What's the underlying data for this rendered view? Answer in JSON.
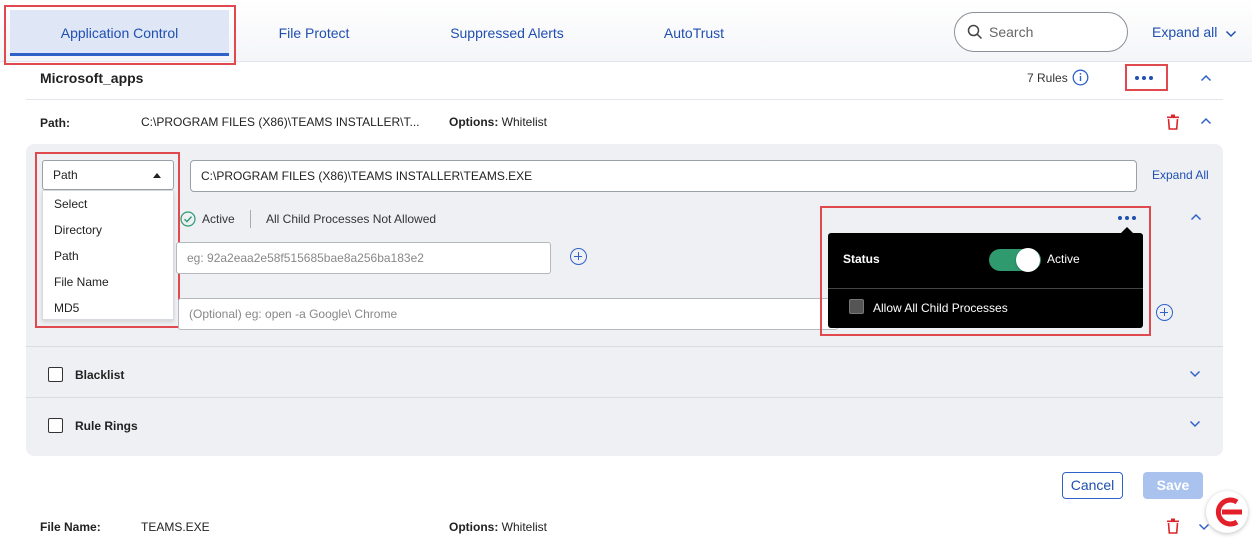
{
  "tabs": [
    {
      "label": "Application Control",
      "active": true
    },
    {
      "label": "File Protect",
      "active": false
    },
    {
      "label": "Suppressed Alerts",
      "active": false
    },
    {
      "label": "AutoTrust",
      "active": false
    }
  ],
  "search": {
    "placeholder": "Search"
  },
  "header": {
    "expand_all": "Expand all"
  },
  "group": {
    "title": "Microsoft_apps",
    "rules_count": "7 Rules"
  },
  "rule1": {
    "path_label": "Path:",
    "path_value": "C:\\PROGRAM FILES (X86)\\TEAMS INSTALLER\\T...",
    "options_label": "Options:",
    "options_value": "Whitelist"
  },
  "editor": {
    "type_selected": "Path",
    "type_options": [
      "Select",
      "Directory",
      "Path",
      "File Name",
      "MD5"
    ],
    "path_value": "C:\\PROGRAM FILES (X86)\\TEAMS INSTALLER\\TEAMS.EXE",
    "expand_all": "Expand All",
    "status_text": "Active",
    "child_text": "All Child Processes Not Allowed",
    "hash_placeholder": "eg: 92a2eaa2e58f515685bae8a256ba183e2",
    "args_placeholder": "(Optional) eg: open -a Google\\ Chrome",
    "blacklist_label": "Blacklist",
    "rule_rings_label": "Rule Rings"
  },
  "popover": {
    "status_label": "Status",
    "status_value": "Active",
    "toggle_on": true,
    "allow_child_label": "Allow All Child Processes"
  },
  "actions": {
    "cancel": "Cancel",
    "save": "Save"
  },
  "rule2": {
    "label": "File Name:",
    "value": "TEAMS.EXE",
    "options_label": "Options:",
    "options_value": "Whitelist"
  },
  "colors": {
    "accent": "#2f62c9",
    "highlight": "#e0494e",
    "toggle_green": "#2e9a6e",
    "delete_red": "#d9262c"
  },
  "icons": [
    "search-icon",
    "info-icon",
    "more-options-icon",
    "chevron-up-icon",
    "chevron-down-icon",
    "trash-icon",
    "check-circle-icon",
    "add-circle-icon",
    "caret-up-icon",
    "brand-logo-icon"
  ]
}
